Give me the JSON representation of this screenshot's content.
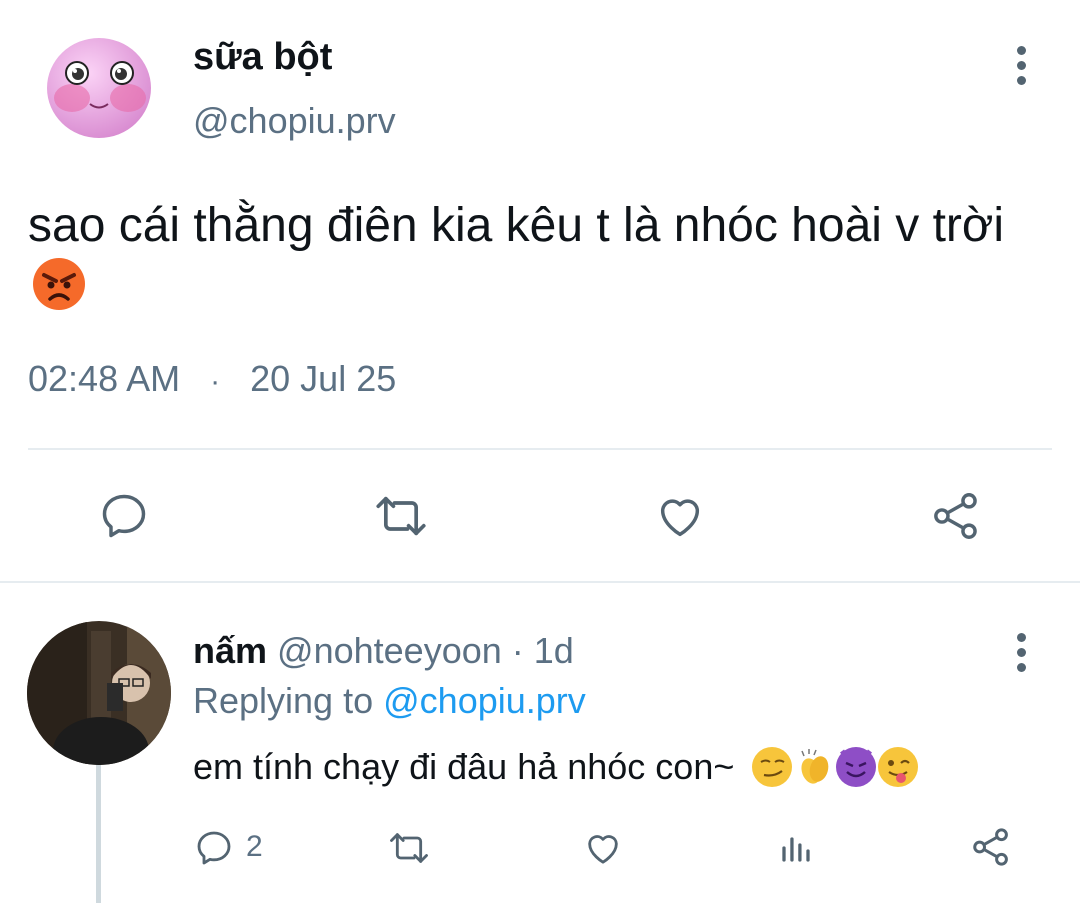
{
  "tweet": {
    "author_name": "sữa bột",
    "author_handle": "@chopiu.prv",
    "text": "sao cái thằng điên kia kêu t là nhóc hoài v trời",
    "emoji": "angry-face",
    "time": "02:48 AM",
    "separator": "·",
    "date": "20 Jul 25"
  },
  "actions": [
    "reply",
    "retweet",
    "like",
    "share"
  ],
  "reply": {
    "author_name": "nấm",
    "author_handle": "@nohteeyoon",
    "age": "· 1d",
    "replying_label": "Replying to",
    "replying_to": "@chopiu.prv",
    "text": "em tính chạy đi đâu hả nhóc con~",
    "emojis": [
      "smirking-face",
      "clapping-hands",
      "smiling-devil",
      "winking-tongue-face"
    ],
    "reply_count": "2"
  },
  "colors": {
    "text": "#0f1419",
    "secondary": "#5b7083",
    "link": "#1d9bf0",
    "divider": "#e6ecf0"
  }
}
